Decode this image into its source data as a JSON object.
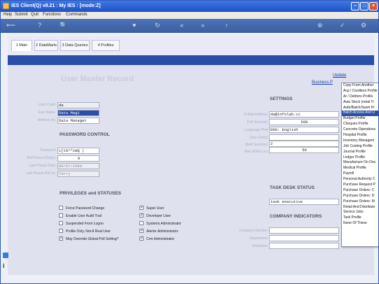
{
  "window": {
    "title": "IES Client(Q) v8.21 : My IES :     [mode:Z]"
  },
  "menu": [
    "Help",
    "Submit",
    "Quit",
    "Functions",
    "Commands"
  ],
  "toolbar": [
    "⟵",
    "?",
    "🔍",
    "♥",
    "↻",
    "«",
    "»",
    "↑",
    "⊕",
    "✓",
    "⚙"
  ],
  "tabs": [
    {
      "label": "1 Main",
      "active": true
    },
    {
      "label": "2 DataMarts",
      "active": false
    },
    {
      "label": "3 Data Queries",
      "active": false
    },
    {
      "label": "4 Profiles",
      "active": false
    }
  ],
  "page": {
    "title": "User Master Record",
    "update_link": "Update",
    "business_link": "Business P"
  },
  "user": {
    "labels": {
      "user_code": "User Code",
      "user_name": "User Name",
      "address_as": "Address As"
    },
    "user_code": "da",
    "user_name": "Data Magi",
    "address_as": "Data Manager"
  },
  "password": {
    "heading": "PASSWORD CONTROL",
    "labels": {
      "password": "Password",
      "roll_period": "Roll Period (Days)",
      "last_roll_date": "Last Passw Date",
      "last_roll_by": "Last Passw Roll by"
    },
    "password": "c[t6^*cmQ |",
    "roll_period": "0",
    "last_roll_date": "08/07/2009",
    "last_roll_by": "Terry"
  },
  "privileges": {
    "heading": "PRIVILEGES and STATUSES",
    "left": [
      {
        "label": "Force Password Change",
        "checked": false
      },
      {
        "label": "Enable User Audit Trail",
        "checked": false
      },
      {
        "label": "Suspended From Logon",
        "checked": false
      },
      {
        "label": "Profile Only, Not A Real User",
        "checked": false
      },
      {
        "label": "May Override Global Poll Setting?",
        "checked": true
      }
    ],
    "right": [
      {
        "label": "Super User",
        "checked": true
      },
      {
        "label": "Developer User",
        "checked": true
      },
      {
        "label": "Systems Administrator",
        "checked": false
      },
      {
        "label": "Alerter Administrator",
        "checked": true
      },
      {
        "label": "Crm Administrator",
        "checked": true
      }
    ]
  },
  "settings": {
    "heading": "SETTINGS",
    "labels": {
      "email": "E-Mail Address",
      "poll_seconds": "Poll Seconds",
      "language": "Language Pref",
      "user_group": "User Group",
      "multi_sessions": "Multi Sessions",
      "max_w": "Max Whse List"
    },
    "email": "da@infolab.cc",
    "poll_seconds": "600",
    "language": "ENG: English",
    "user_group": "",
    "multi_sessions": "2",
    "max_w": "50"
  },
  "task_desk": {
    "heading": "TASK DESK STATUS",
    "value": "task executive"
  },
  "company": {
    "heading": "COMPANY INDICATORS",
    "labels": {
      "number": "Company Number",
      "department": "Department",
      "telephone": "Telephone"
    }
  },
  "dropdown": {
    "selected_index": 5,
    "items": [
      "Copy From Another",
      "Acp / Creditors Profile",
      "Ar / Debtors Profile",
      "Auto Stock (retail Tr",
      "Auth/Batch/Sweh Pr",
      "Batch Access And U",
      "Budget Profile",
      "Cheques Profile",
      "Concrete Operations",
      "Hospital Profile",
      "Inventory Managem",
      "Job Costing Profile",
      "Journal Profile",
      "Ledger Profile",
      "Manufacture On Des",
      "Medical Profile",
      "Payroll",
      "Personal Authority C",
      "Purchase Request P",
      "Purchase Orders: C",
      "Purchase Orders: D",
      "Purchase Orders: M",
      "Retail And Distribute",
      "Service Jobs",
      "Task Profile",
      "None Of These"
    ]
  }
}
